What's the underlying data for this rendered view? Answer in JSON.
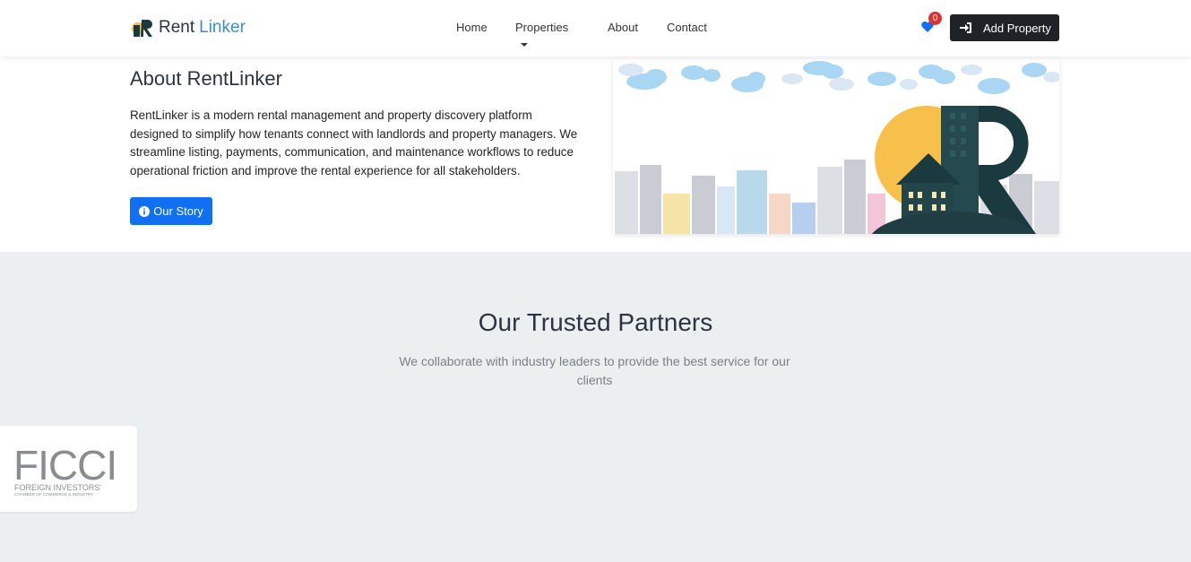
{
  "brand": {
    "name_part1": "Rent",
    "name_part2": "Linker"
  },
  "nav": {
    "home": "Home",
    "properties": "Properties",
    "about": "About",
    "contact": "Contact"
  },
  "favorites": {
    "count": "0",
    "icon": "heart-icon"
  },
  "add_property": {
    "label": "Add Property",
    "icon": "sign-in-icon"
  },
  "about": {
    "title": "About RentLinker",
    "text": "RentLinker is a modern rental management and property discovery platform designed to simplify how tenants connect with landlords and property managers. We streamline listing, payments, communication, and maintenance workflows to reduce operational friction and improve the rental experience for all stakeholders.",
    "button_label": "Our Story"
  },
  "partners": {
    "title": "Our Trusted Partners",
    "subtitle": "We collaborate with industry leaders to provide the best service for our clients",
    "logos": [
      {
        "name": "FICCI",
        "tagline": "FOREIGN INVESTORS'",
        "subline": "CHAMBER OF COMMERCE & INDUSTRY"
      }
    ]
  },
  "colors": {
    "accent_blue": "#1170f2",
    "brand_light_blue": "#3b8fd1",
    "dark_button": "#1f2327",
    "badge_red": "#e03131",
    "section_bg": "#eceff0"
  }
}
